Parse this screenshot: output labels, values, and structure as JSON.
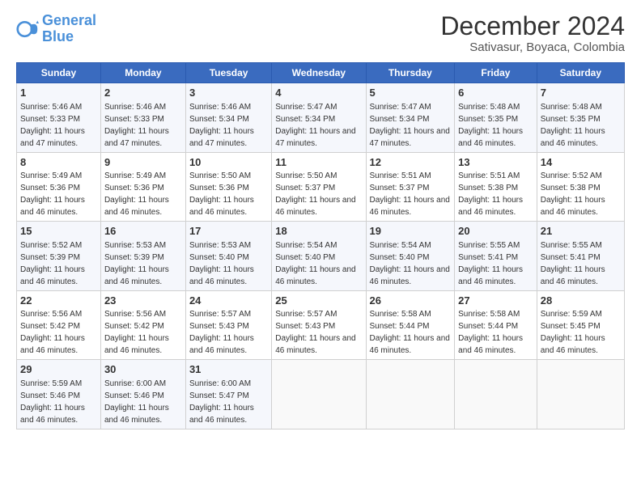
{
  "header": {
    "logo_line1": "General",
    "logo_line2": "Blue",
    "title": "December 2024",
    "subtitle": "Sativasur, Boyaca, Colombia"
  },
  "days_of_week": [
    "Sunday",
    "Monday",
    "Tuesday",
    "Wednesday",
    "Thursday",
    "Friday",
    "Saturday"
  ],
  "weeks": [
    [
      {
        "day": 1,
        "sunrise": "5:46 AM",
        "sunset": "5:33 PM",
        "daylight": "11 hours and 47 minutes."
      },
      {
        "day": 2,
        "sunrise": "5:46 AM",
        "sunset": "5:33 PM",
        "daylight": "11 hours and 47 minutes."
      },
      {
        "day": 3,
        "sunrise": "5:46 AM",
        "sunset": "5:34 PM",
        "daylight": "11 hours and 47 minutes."
      },
      {
        "day": 4,
        "sunrise": "5:47 AM",
        "sunset": "5:34 PM",
        "daylight": "11 hours and 47 minutes."
      },
      {
        "day": 5,
        "sunrise": "5:47 AM",
        "sunset": "5:34 PM",
        "daylight": "11 hours and 47 minutes."
      },
      {
        "day": 6,
        "sunrise": "5:48 AM",
        "sunset": "5:35 PM",
        "daylight": "11 hours and 46 minutes."
      },
      {
        "day": 7,
        "sunrise": "5:48 AM",
        "sunset": "5:35 PM",
        "daylight": "11 hours and 46 minutes."
      }
    ],
    [
      {
        "day": 8,
        "sunrise": "5:49 AM",
        "sunset": "5:36 PM",
        "daylight": "11 hours and 46 minutes."
      },
      {
        "day": 9,
        "sunrise": "5:49 AM",
        "sunset": "5:36 PM",
        "daylight": "11 hours and 46 minutes."
      },
      {
        "day": 10,
        "sunrise": "5:50 AM",
        "sunset": "5:36 PM",
        "daylight": "11 hours and 46 minutes."
      },
      {
        "day": 11,
        "sunrise": "5:50 AM",
        "sunset": "5:37 PM",
        "daylight": "11 hours and 46 minutes."
      },
      {
        "day": 12,
        "sunrise": "5:51 AM",
        "sunset": "5:37 PM",
        "daylight": "11 hours and 46 minutes."
      },
      {
        "day": 13,
        "sunrise": "5:51 AM",
        "sunset": "5:38 PM",
        "daylight": "11 hours and 46 minutes."
      },
      {
        "day": 14,
        "sunrise": "5:52 AM",
        "sunset": "5:38 PM",
        "daylight": "11 hours and 46 minutes."
      }
    ],
    [
      {
        "day": 15,
        "sunrise": "5:52 AM",
        "sunset": "5:39 PM",
        "daylight": "11 hours and 46 minutes."
      },
      {
        "day": 16,
        "sunrise": "5:53 AM",
        "sunset": "5:39 PM",
        "daylight": "11 hours and 46 minutes."
      },
      {
        "day": 17,
        "sunrise": "5:53 AM",
        "sunset": "5:40 PM",
        "daylight": "11 hours and 46 minutes."
      },
      {
        "day": 18,
        "sunrise": "5:54 AM",
        "sunset": "5:40 PM",
        "daylight": "11 hours and 46 minutes."
      },
      {
        "day": 19,
        "sunrise": "5:54 AM",
        "sunset": "5:40 PM",
        "daylight": "11 hours and 46 minutes."
      },
      {
        "day": 20,
        "sunrise": "5:55 AM",
        "sunset": "5:41 PM",
        "daylight": "11 hours and 46 minutes."
      },
      {
        "day": 21,
        "sunrise": "5:55 AM",
        "sunset": "5:41 PM",
        "daylight": "11 hours and 46 minutes."
      }
    ],
    [
      {
        "day": 22,
        "sunrise": "5:56 AM",
        "sunset": "5:42 PM",
        "daylight": "11 hours and 46 minutes."
      },
      {
        "day": 23,
        "sunrise": "5:56 AM",
        "sunset": "5:42 PM",
        "daylight": "11 hours and 46 minutes."
      },
      {
        "day": 24,
        "sunrise": "5:57 AM",
        "sunset": "5:43 PM",
        "daylight": "11 hours and 46 minutes."
      },
      {
        "day": 25,
        "sunrise": "5:57 AM",
        "sunset": "5:43 PM",
        "daylight": "11 hours and 46 minutes."
      },
      {
        "day": 26,
        "sunrise": "5:58 AM",
        "sunset": "5:44 PM",
        "daylight": "11 hours and 46 minutes."
      },
      {
        "day": 27,
        "sunrise": "5:58 AM",
        "sunset": "5:44 PM",
        "daylight": "11 hours and 46 minutes."
      },
      {
        "day": 28,
        "sunrise": "5:59 AM",
        "sunset": "5:45 PM",
        "daylight": "11 hours and 46 minutes."
      }
    ],
    [
      {
        "day": 29,
        "sunrise": "5:59 AM",
        "sunset": "5:46 PM",
        "daylight": "11 hours and 46 minutes."
      },
      {
        "day": 30,
        "sunrise": "6:00 AM",
        "sunset": "5:46 PM",
        "daylight": "11 hours and 46 minutes."
      },
      {
        "day": 31,
        "sunrise": "6:00 AM",
        "sunset": "5:47 PM",
        "daylight": "11 hours and 46 minutes."
      },
      null,
      null,
      null,
      null
    ]
  ],
  "colors": {
    "header_bg": "#3a6bbf",
    "odd_row": "#f5f7fc",
    "even_row": "#ffffff"
  }
}
